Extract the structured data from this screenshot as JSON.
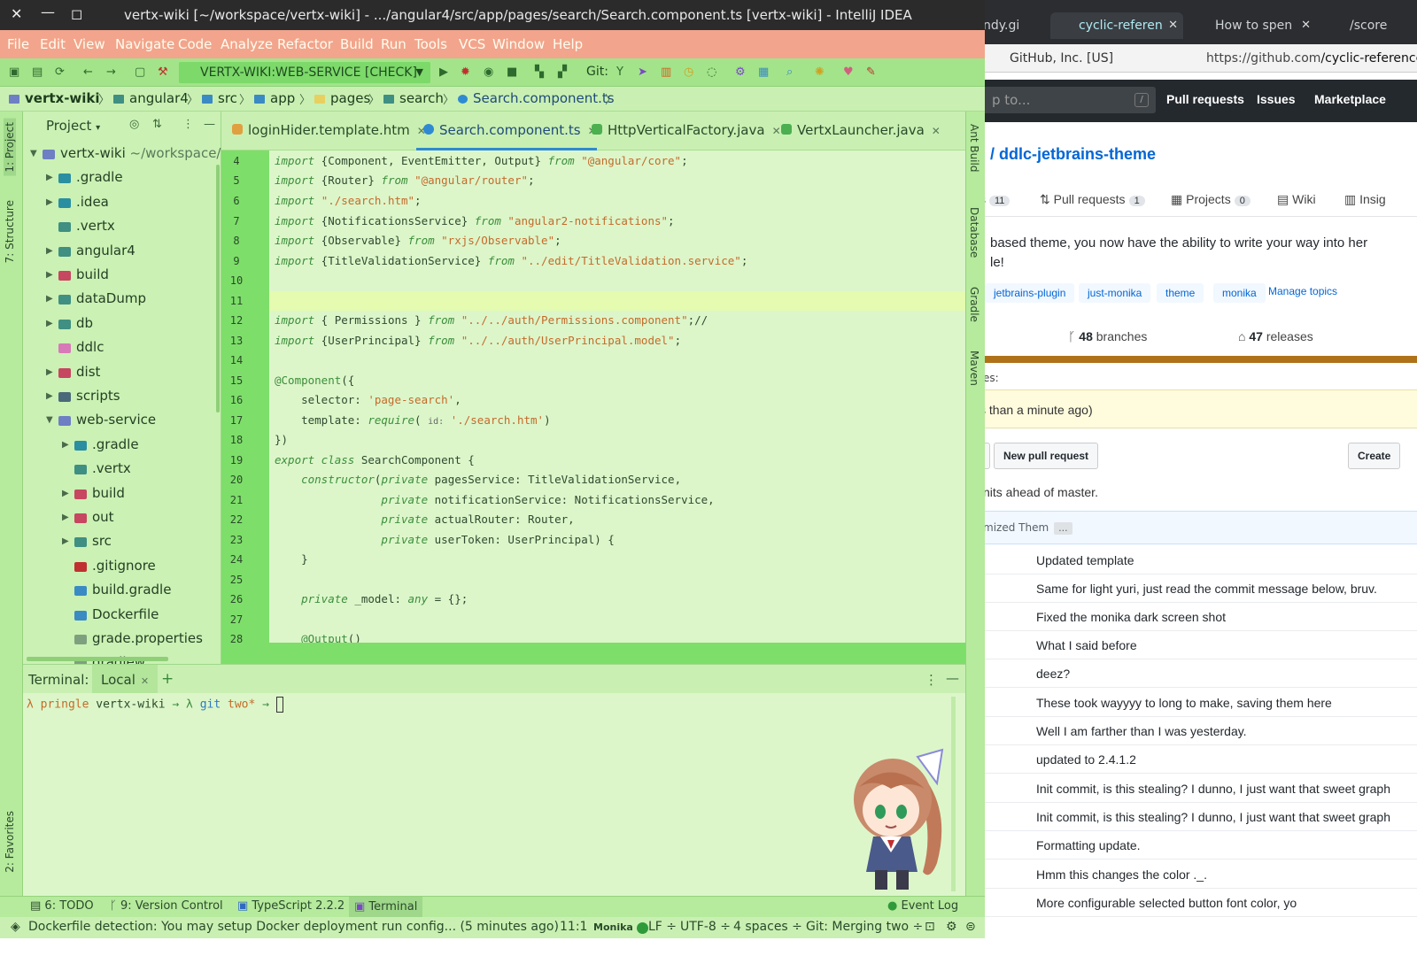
{
  "browser": {
    "tabs": [
      {
        "label": "ndy.gi"
      },
      {
        "label": "cyclic-referen"
      },
      {
        "label": "How to spen"
      },
      {
        "label": "/score"
      }
    ],
    "org_badge": "GitHub, Inc. [US]",
    "url_prefix": "https://github.com",
    "url_path": "/cyclic-reference/ddlc-jetbrains-the",
    "search_placeholder": "p to...",
    "search_slash": "/",
    "nav": [
      "Pull requests",
      "Issues",
      "Marketplace"
    ],
    "repo_title": "/ ddlc-jetbrains-theme",
    "repo_tabs": [
      {
        "label": "s",
        "count": "11"
      },
      {
        "label": "Pull requests",
        "count": "1"
      },
      {
        "label": "Projects",
        "count": "0"
      },
      {
        "label": "Wiki",
        "count": ""
      },
      {
        "label": "Insig",
        "count": ""
      }
    ],
    "description_line1": "based theme, you now have the ability to write your way into her",
    "description_line2": "le!",
    "topics": [
      "jetbrains-plugin",
      "just-monika",
      "theme",
      "monika"
    ],
    "manage_topics": "Manage topics",
    "branches_count": "48",
    "branches_label": "branches",
    "releases_count": "47",
    "releases_label": "releases",
    "contrib_note": "es:",
    "notice": "s than a minute ago)",
    "new_pr_button": "New pull request",
    "create_button": "Create",
    "ahead_text": "nits ahead of master.",
    "latest_commit": "mized Them",
    "latest_more": "...",
    "commits": [
      "Updated template",
      "Same for light yuri, just read the commit message below, bruv.",
      "Fixed the monika dark screen shot",
      "What I said before",
      "deez?",
      "These took wayyyy to long to make, saving them here",
      "Well I am farther than I was yesterday.",
      "updated to 2.4.1.2",
      "Init commit, is this stealing? I dunno, I just want that sweet graph",
      "Init commit, is this stealing? I dunno, I just want that sweet graph",
      "Formatting update.",
      "Hmm this changes the color ._.",
      "More configurable selected button font color, yo"
    ]
  },
  "ide": {
    "title": "vertx-wiki [~/workspace/vertx-wiki] - .../angular4/src/app/pages/search/Search.component.ts [vertx-wiki] - IntelliJ IDEA",
    "window_buttons": [
      "✕",
      "—",
      "◻"
    ],
    "menu": [
      "File",
      "Edit",
      "View",
      "Navigate",
      "Code",
      "Analyze",
      "Refactor",
      "Build",
      "Run",
      "Tools",
      "VCS",
      "Window",
      "Help"
    ],
    "run_config": "VERTX-WIKI:WEB-SERVICE [CHECK]",
    "git_label": "Git:",
    "breadcrumbs": [
      "vertx-wiki",
      "angular4",
      "src",
      "app",
      "pages",
      "search",
      "Search.component.ts"
    ],
    "left_tools": [
      "1: Project",
      "7: Structure",
      "2: Favorites"
    ],
    "right_tools": [
      "Ant Build",
      "Database",
      "Gradle",
      "Maven"
    ],
    "project_title": "Project",
    "tree": [
      {
        "name": "vertx-wiki",
        "hint": "~/workspace/ver",
        "color": "#6e7fc4"
      },
      {
        "name": ".gradle",
        "hint": "",
        "color": "#2a8fa0"
      },
      {
        "name": ".idea",
        "hint": "",
        "color": "#2a8fa0"
      },
      {
        "name": ".vertx",
        "hint": "",
        "color": "#3f8f82"
      },
      {
        "name": "angular4",
        "hint": "",
        "color": "#3f8f82"
      },
      {
        "name": "build",
        "hint": "",
        "color": "#c74660"
      },
      {
        "name": "dataDump",
        "hint": "",
        "color": "#3f8f82"
      },
      {
        "name": "db",
        "hint": "",
        "color": "#3f8f82"
      },
      {
        "name": "ddlc",
        "hint": "",
        "color": "#d77ab8"
      },
      {
        "name": "dist",
        "hint": "",
        "color": "#c74660"
      },
      {
        "name": "scripts",
        "hint": "",
        "color": "#4a6a7a"
      },
      {
        "name": "web-service",
        "hint": "",
        "color": "#6e7fc4"
      },
      {
        "name": ".gradle",
        "hint": "",
        "color": "#2a8fa0"
      },
      {
        "name": ".vertx",
        "hint": "",
        "color": "#3f8f82"
      },
      {
        "name": "build",
        "hint": "",
        "color": "#c74660"
      },
      {
        "name": "out",
        "hint": "",
        "color": "#c74660"
      },
      {
        "name": "src",
        "hint": "",
        "color": "#3f8f82"
      },
      {
        "name": ".gitignore",
        "hint": "",
        "color": "#c03030"
      },
      {
        "name": "build.gradle",
        "hint": "",
        "color": "#3a8ac4"
      },
      {
        "name": "Dockerfile",
        "hint": "",
        "color": "#3a8ac4"
      },
      {
        "name": "grade.properties",
        "hint": "",
        "color": "#7fa07f"
      },
      {
        "name": "gradlew",
        "hint": "",
        "color": "#7fa07f"
      }
    ],
    "tabs": [
      {
        "label": "loginHider.template.htm",
        "color": "#e0a040"
      },
      {
        "label": "Search.component.ts",
        "color": "#2f8ad1"
      },
      {
        "label": "HttpVerticalFactory.java",
        "color": "#4caf50"
      },
      {
        "label": "VertxLauncher.java",
        "color": "#4caf50"
      }
    ],
    "line_numbers": [
      "4",
      "5",
      "6",
      "7",
      "8",
      "9",
      "10",
      "11",
      "12",
      "13",
      "14",
      "15",
      "16",
      "17",
      "18",
      "19",
      "20",
      "21",
      "22",
      "23",
      "24",
      "25",
      "26",
      "27",
      "28"
    ],
    "terminal": {
      "label": "Terminal:",
      "tab": "Local",
      "add": "+",
      "prompt_user": "λ pringle",
      "prompt_dir": "vertx-wiki",
      "prompt_arrow": "→ λ",
      "prompt_git": "git",
      "prompt_branch": "two*",
      "prompt_end": "→"
    },
    "tool_tabs": [
      "6: TODO",
      "9: Version Control",
      "TypeScript 2.2.2",
      "Terminal",
      "Event Log"
    ],
    "status": {
      "message": "Dockerfile detection: You may setup Docker deployment run config... (5 minutes ago)",
      "position": "11:1",
      "theme": "Monika",
      "line_sep": "LF ÷",
      "encoding": "UTF-8 ÷",
      "indent": "4 spaces ÷",
      "git": "Git: Merging two ÷"
    }
  }
}
